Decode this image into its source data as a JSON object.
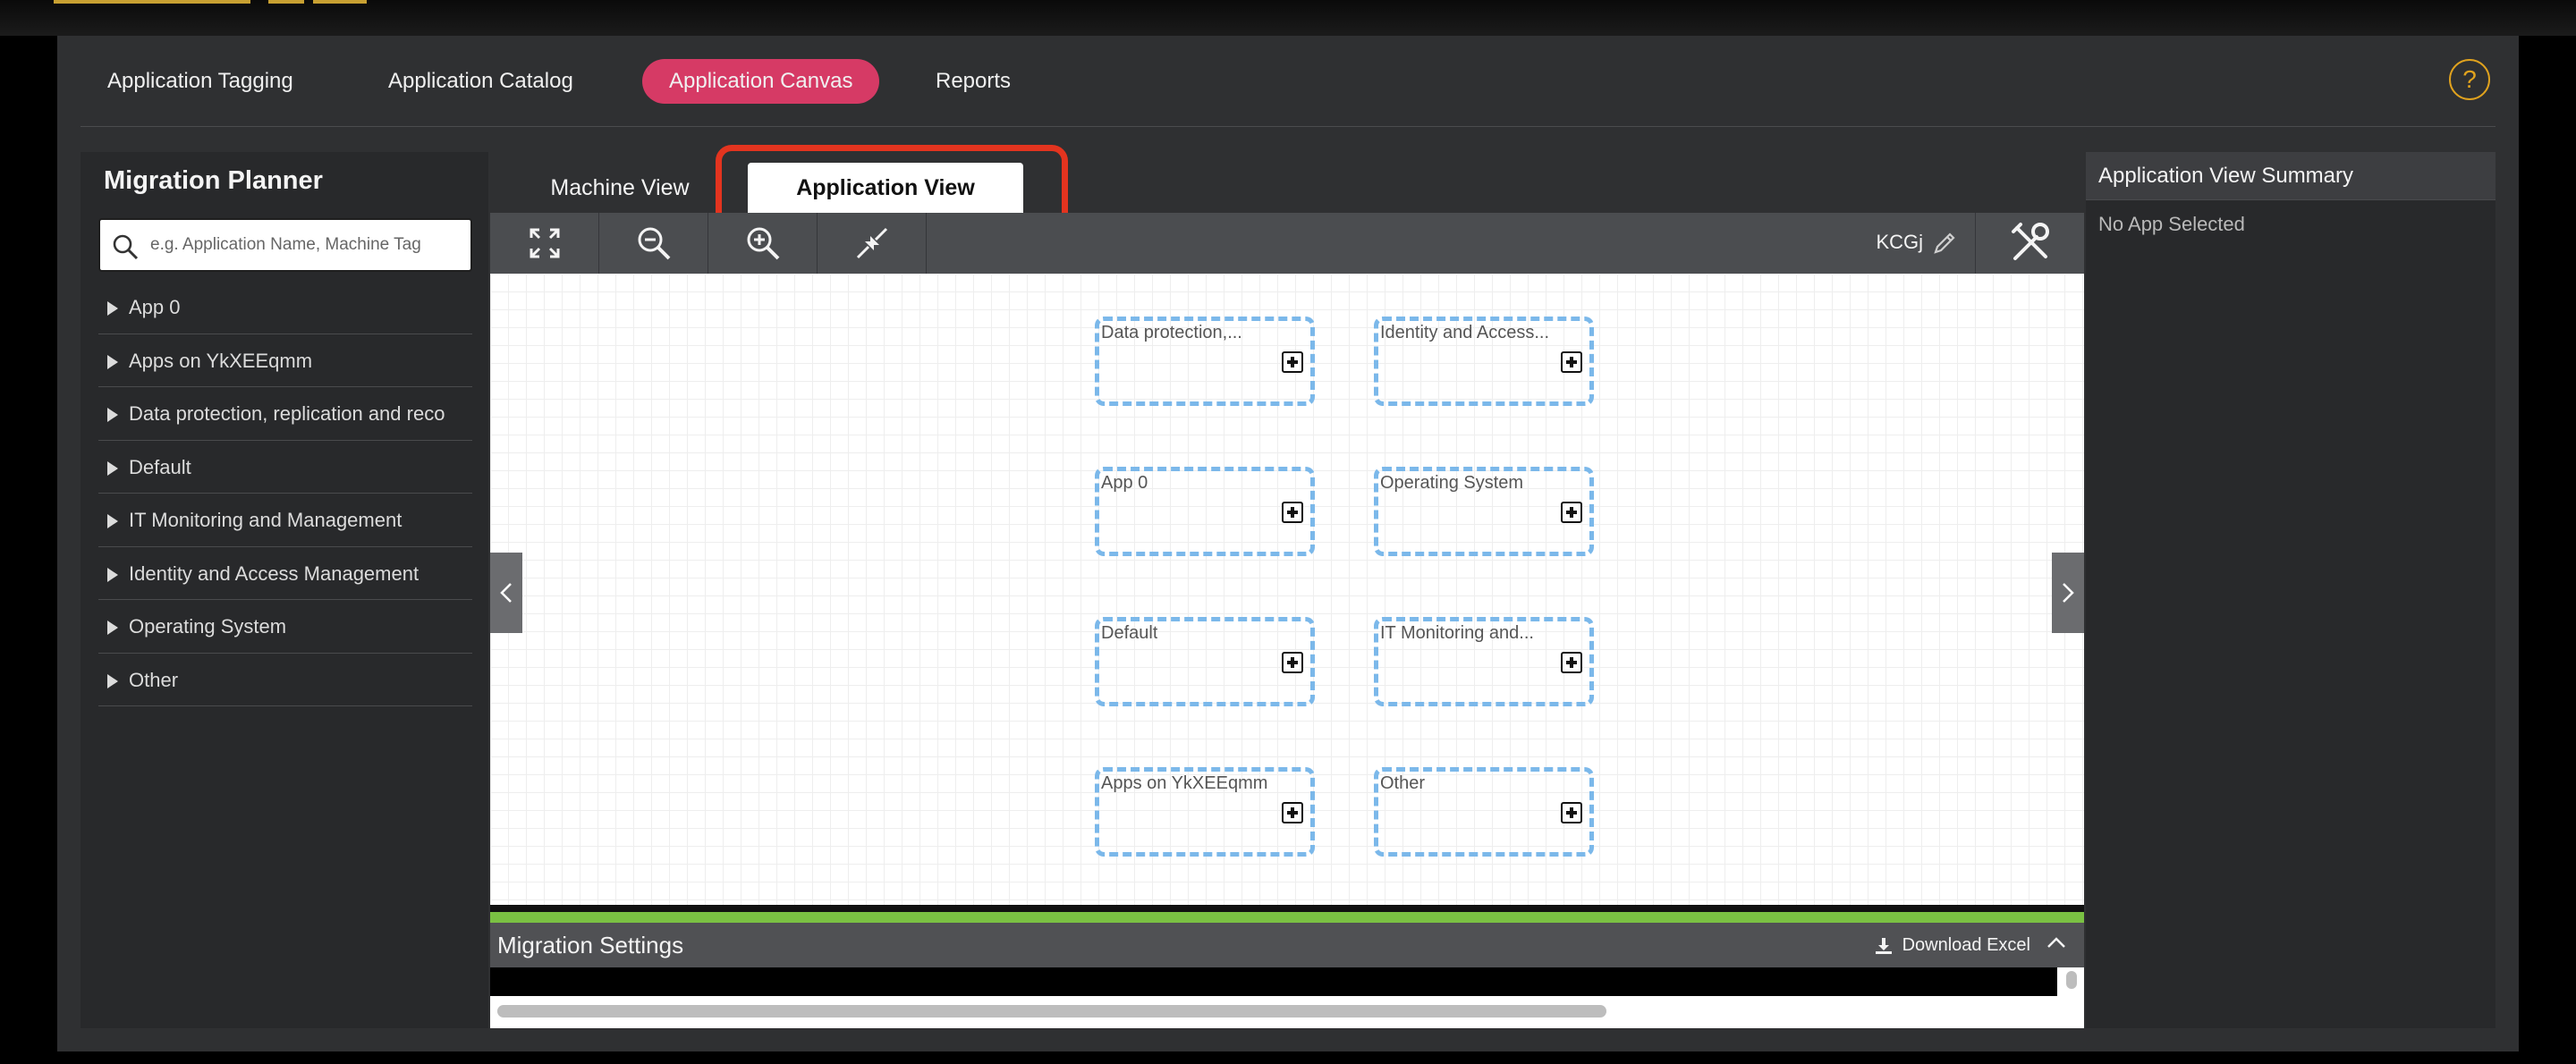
{
  "nav": {
    "items": [
      {
        "label": "Application Tagging",
        "active": false
      },
      {
        "label": "Application Catalog",
        "active": false
      },
      {
        "label": "Application Canvas",
        "active": true
      },
      {
        "label": "Reports",
        "active": false
      }
    ],
    "help_label": "?"
  },
  "sidebar": {
    "title": "Migration Planner",
    "search_placeholder": "e.g. Application Name, Machine Tag",
    "items": [
      {
        "label": "App 0"
      },
      {
        "label": "Apps on YkXEEqmm"
      },
      {
        "label": "Data protection, replication and reco"
      },
      {
        "label": "Default"
      },
      {
        "label": "IT Monitoring and Management"
      },
      {
        "label": "Identity and Access Management"
      },
      {
        "label": "Operating System"
      },
      {
        "label": "Other"
      }
    ]
  },
  "view_tabs": [
    {
      "label": "Machine View",
      "active": false
    },
    {
      "label": "Application View",
      "active": true
    }
  ],
  "toolbar": {
    "user_code": "KCGj",
    "tools": [
      "fit-screen-icon",
      "zoom-out-icon",
      "zoom-in-icon",
      "collapse-arrows-icon"
    ]
  },
  "canvas": {
    "nodes": [
      {
        "label": "Data protection,..."
      },
      {
        "label": "Identity and Access..."
      },
      {
        "label": "App 0"
      },
      {
        "label": "Operating System"
      },
      {
        "label": "Default"
      },
      {
        "label": "IT Monitoring and..."
      },
      {
        "label": "Apps on YkXEEqmm"
      },
      {
        "label": "Other"
      }
    ]
  },
  "settings": {
    "title": "Migration Settings",
    "download_label": "Download Excel"
  },
  "summary": {
    "title": "Application View Summary",
    "empty_text": "No App Selected"
  },
  "colors": {
    "accent": "#d63a65",
    "highlight": "#e3341f",
    "progress": "#7ac143",
    "node_border": "#7bb8ea",
    "help": "#e0a21e"
  }
}
